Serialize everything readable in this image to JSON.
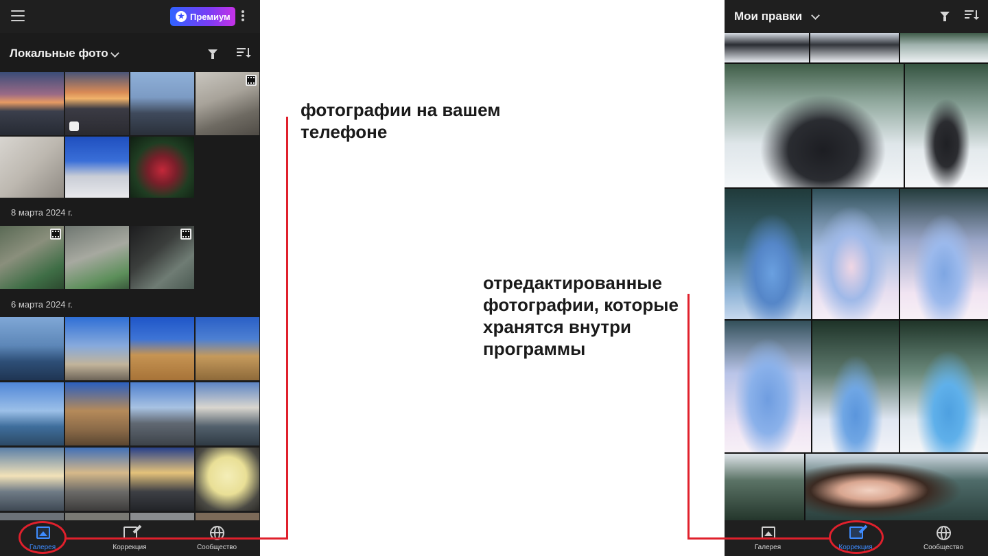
{
  "left_app": {
    "premium_label": "Премиум",
    "section_title": "Локальные фото",
    "dates": [
      "8 марта 2024 г.",
      "6 марта 2024 г."
    ],
    "nav": [
      {
        "label": "Галерея",
        "active": true
      },
      {
        "label": "Коррекция",
        "active": false
      },
      {
        "label": "Сообщество",
        "active": false
      }
    ]
  },
  "right_app": {
    "section_title": "Мои правки",
    "nav": [
      {
        "label": "Галерея",
        "active": false
      },
      {
        "label": "Коррекция",
        "active": true
      },
      {
        "label": "Сообщество",
        "active": false
      }
    ]
  },
  "annotations": {
    "local_photos_caption": "фотографии на вашем телефоне",
    "edited_photos_caption": "отредактированные фотографии, которые хранятся внутри программы"
  },
  "colors": {
    "accent_red": "#e0202c",
    "active_blue": "#3e8cff",
    "premium_gradient_start": "#2f63ff",
    "premium_gradient_end": "#c632e6",
    "app_background": "#1b1b1b"
  },
  "icons": [
    "menu-icon",
    "star-icon",
    "more-icon",
    "chevron-down-icon",
    "filter-icon",
    "sort-icon",
    "gallery-icon",
    "edit-icon",
    "globe-icon",
    "video-icon",
    "edited-icon"
  ]
}
